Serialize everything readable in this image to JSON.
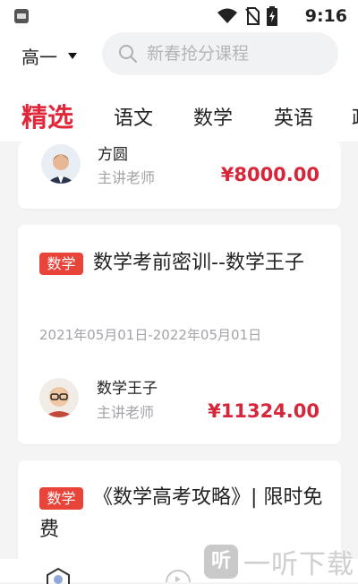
{
  "status_bar": {
    "time": "9:16",
    "icons": [
      "app-icon",
      "wifi-icon",
      "no-sim-icon",
      "battery-charging-icon"
    ]
  },
  "header": {
    "grade": "高一",
    "search_placeholder": "新春抢分课程"
  },
  "tabs": [
    {
      "label": "精选",
      "active": true
    },
    {
      "label": "语文"
    },
    {
      "label": "数学"
    },
    {
      "label": "英语"
    },
    {
      "label": "政"
    }
  ],
  "courses": [
    {
      "teacher_name": "方圆",
      "teacher_role": "主讲老师",
      "price": "¥8000.00"
    },
    {
      "subject": "数学",
      "title": "数学考前密训--数学王子",
      "dates": "2021年05月01日-2022年05月01日",
      "teacher_name": "数学王子",
      "teacher_role": "主讲老师",
      "price": "¥11324.00"
    },
    {
      "subject": "数学",
      "title": "《数学高考攻略》| 限时免费"
    }
  ],
  "watermark": {
    "icon_char": "听",
    "text": "一听下载"
  },
  "colors": {
    "accent": "#e0283a",
    "badge": "#e8443a",
    "price": "#d7263a"
  }
}
